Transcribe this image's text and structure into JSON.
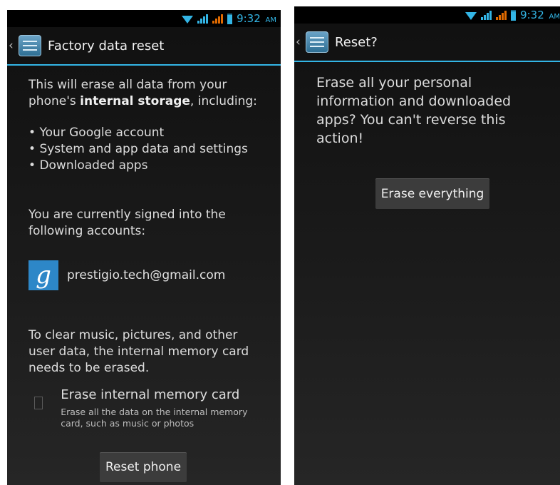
{
  "status_bar": {
    "time": "9:32",
    "ampm": "AM"
  },
  "left_screen": {
    "title": "Factory data reset",
    "intro_text": "This will erase all data from your phone's ",
    "intro_bold": "internal storage",
    "intro_tail": ", including:",
    "items": [
      "Your Google account",
      "System and app data and settings",
      "Downloaded apps"
    ],
    "accounts_text": "You are currently signed into the following accounts:",
    "account_icon_letter": "g",
    "account_email": "prestigio.tech@gmail.com",
    "clear_text": "To clear music, pictures, and other user data, the internal memory card needs to be erased.",
    "checkbox_title": "Erase internal memory card",
    "checkbox_summary": "Erase all the data on the internal memory card, such as music or photos",
    "checkbox_checked": false,
    "reset_button": "Reset phone"
  },
  "right_screen": {
    "title": "Reset?",
    "message": "Erase all your personal information and downloaded apps? You can't reverse this action!",
    "erase_button": "Erase everything"
  },
  "colors": {
    "accent": "#33b5e5",
    "signal_orange": "#e06a00",
    "google_blue": "#2d87c8"
  }
}
